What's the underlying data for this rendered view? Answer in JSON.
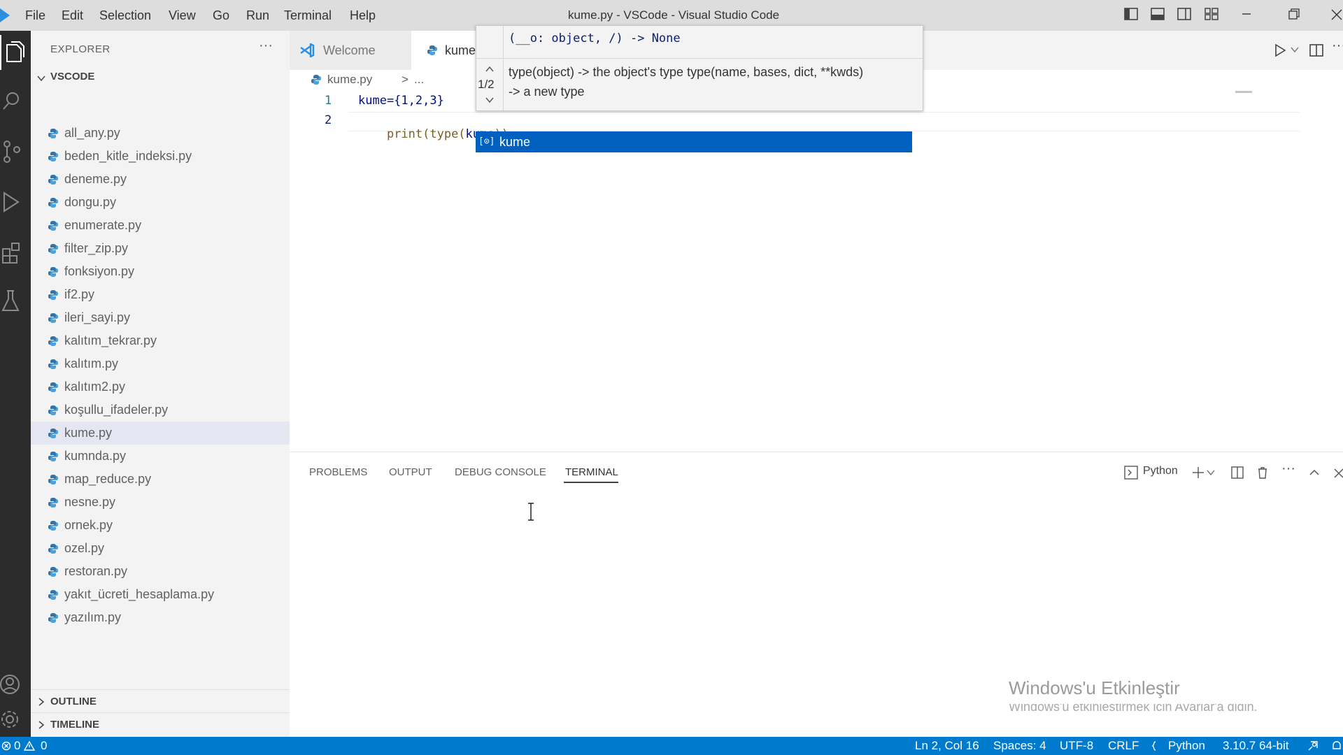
{
  "menu": [
    "File",
    "Edit",
    "Selection",
    "View",
    "Go",
    "Run",
    "Terminal",
    "Help"
  ],
  "window_title": "kume.py - VSCode - Visual Studio Code",
  "sidebar": {
    "title": "EXPLORER",
    "more": "···",
    "folder": "VSCODE",
    "files": [
      "all_any.py",
      "beden_kitle_indeksi.py",
      "deneme.py",
      "dongu.py",
      "enumerate.py",
      "filter_zip.py",
      "fonksiyon.py",
      "if2.py",
      "ileri_sayi.py",
      "kalıtım_tekrar.py",
      "kalıtım.py",
      "kalıtım2.py",
      "koşullu_ifadeler.py",
      "kume.py",
      "kumnda.py",
      "map_reduce.py",
      "nesne.py",
      "ornek.py",
      "ozel.py",
      "restoran.py",
      "yakıt_ücreti_hesaplama.py",
      "yazılım.py"
    ],
    "selected_file": "kume.py",
    "outline": "OUTLINE",
    "timeline": "TIMELINE"
  },
  "tabs": [
    {
      "label": "Welcome"
    },
    {
      "label": "kume"
    }
  ],
  "breadcrumb": {
    "file": "kume.py",
    "sep": ">",
    "rest": "..."
  },
  "code": {
    "line_numbers": [
      "1",
      "2"
    ],
    "line1": "kume={1,2,3}",
    "line2_a": "print(type(",
    "line2_b": "kume",
    "line2_c": "))"
  },
  "hover": {
    "signature": "(__o: object, /) -> None",
    "counter": "1/2",
    "doc_line1": "type(object) -> the object's type type(name, bases, dict, **kwds)",
    "doc_line2": "-> a new type"
  },
  "suggest": {
    "icon": "[⊙]",
    "label": "kume"
  },
  "panel": {
    "tabs": [
      "PROBLEMS",
      "OUTPUT",
      "DEBUG CONSOLE",
      "TERMINAL"
    ],
    "active_tab": "TERMINAL",
    "terminal_name": "Python"
  },
  "watermark": {
    "line1": "Windows'u Etkinleştir",
    "line2": "Windows'u etkinleştirmek için Ayarlar'a gidin."
  },
  "status": {
    "errors": "0",
    "warnings": "0",
    "position": "Ln 2, Col 16",
    "spaces": "Spaces: 4",
    "encoding": "UTF-8",
    "eol": "CRLF",
    "language": "Python",
    "interpreter": "3.10.7 64-bit"
  },
  "colors": {
    "accent": "#007acc",
    "selection": "#0060c0",
    "activity": "#2c2c2c"
  }
}
